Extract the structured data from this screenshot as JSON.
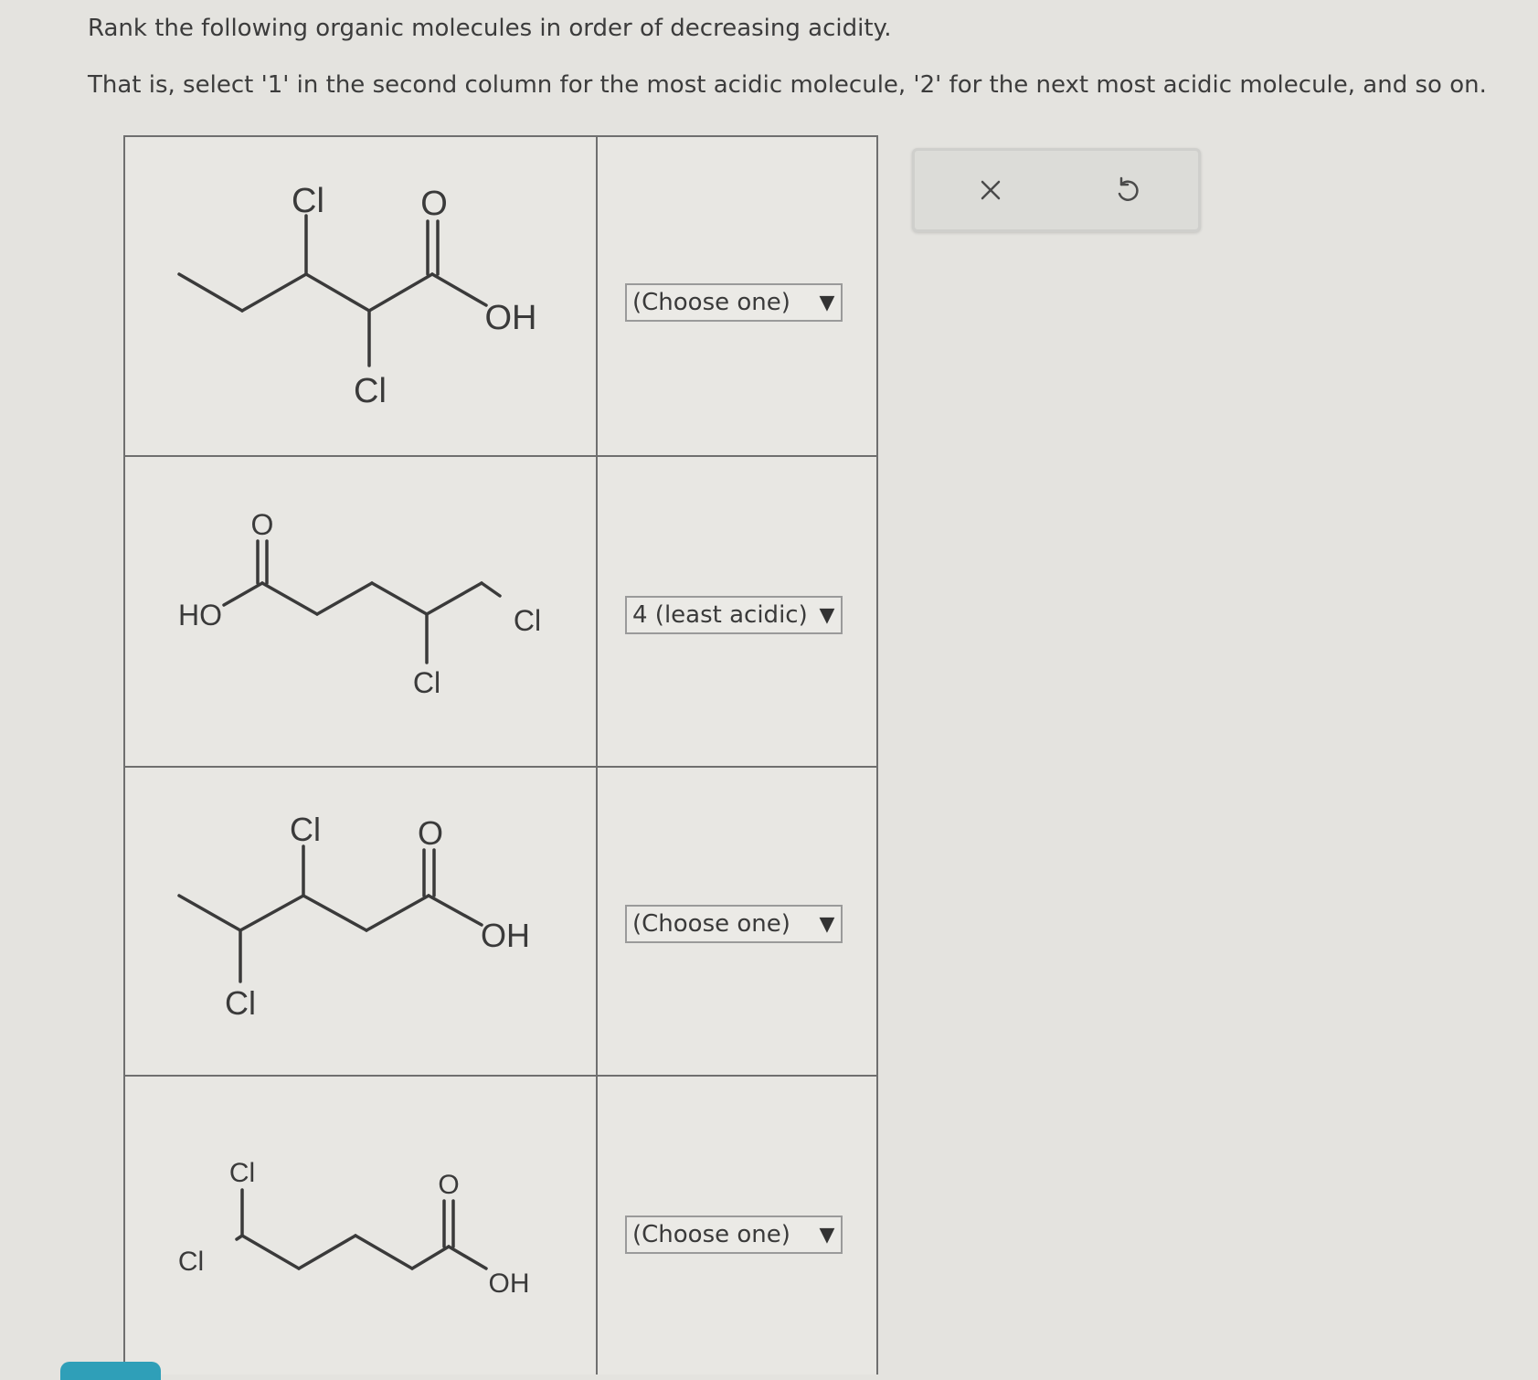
{
  "question": {
    "line1": "Rank the following organic molecules in order of decreasing acidity.",
    "line2": "That is, select '1' in the second column for the most acidic molecule, '2' for the next most acidic molecule, and so on."
  },
  "molecules": [
    {
      "labels": {
        "cl_top": "Cl",
        "o": "O",
        "oh": "OH",
        "cl_bottom": "Cl"
      },
      "rank": "(Choose one)"
    },
    {
      "labels": {
        "o": "O",
        "ho": "HO",
        "cl_end": "Cl",
        "cl_sub": "Cl"
      },
      "rank": "4 (least acidic)"
    },
    {
      "labels": {
        "cl_top": "Cl",
        "o": "O",
        "oh": "OH",
        "cl_bottom": "Cl"
      },
      "rank": "(Choose one)"
    },
    {
      "labels": {
        "cl_top": "Cl",
        "cl_left": "Cl",
        "o": "O",
        "oh": "OH"
      },
      "rank": "(Choose one)"
    }
  ],
  "select_arrow": "▼",
  "actions": {
    "clear_icon": "x-icon",
    "undo_icon": "undo-icon"
  }
}
